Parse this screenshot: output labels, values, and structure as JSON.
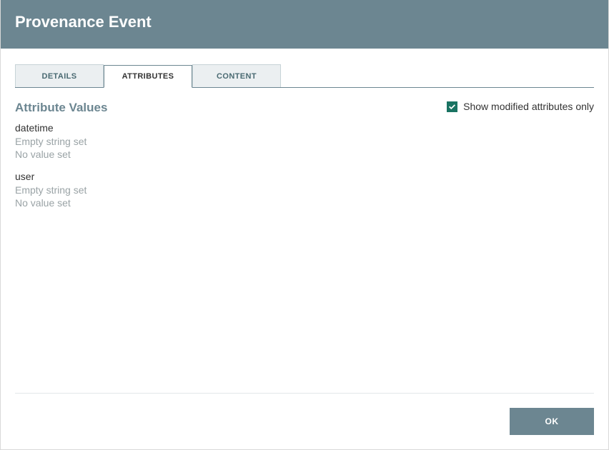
{
  "header": {
    "title": "Provenance Event"
  },
  "tabs": {
    "details": "DETAILS",
    "attributes": "ATTRIBUTES",
    "content": "CONTENT"
  },
  "panel": {
    "heading": "Attribute Values",
    "show_modified_label": "Show modified attributes only",
    "show_modified_checked": true
  },
  "attributes": [
    {
      "name": "datetime",
      "previous": "Empty string set",
      "current": "No value set"
    },
    {
      "name": "user",
      "previous": "Empty string set",
      "current": "No value set"
    }
  ],
  "footer": {
    "ok": "OK"
  }
}
